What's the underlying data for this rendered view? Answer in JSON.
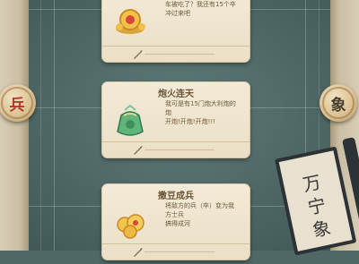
{
  "board": {
    "pieces": [
      {
        "label": "兵",
        "side": "red"
      },
      {
        "label": "象",
        "side": "dark"
      }
    ],
    "scroll_text": [
      "万",
      "宁",
      "象"
    ]
  },
  "cards": [
    {
      "title": "",
      "description": "车被吃了？我还有15个卒\n冲过来吧",
      "icon": "gold-treasure-icon"
    },
    {
      "title": "炮火连天",
      "description": "我可是有15门炮大利炮的炮\n开炮!开炮!开炮!!!",
      "icon": "green-bag-icon"
    },
    {
      "title": "撒豆成兵",
      "description": "将敌方的兵（卒）变为我方士兵\n搞得成河",
      "icon": "gold-coins-icon"
    }
  ],
  "colors": {
    "board": "#4f6866",
    "card": "#f1e7d2",
    "title_text": "#6b5638",
    "desc_text": "#6e5a3d",
    "piece_red": "#b6372c"
  }
}
